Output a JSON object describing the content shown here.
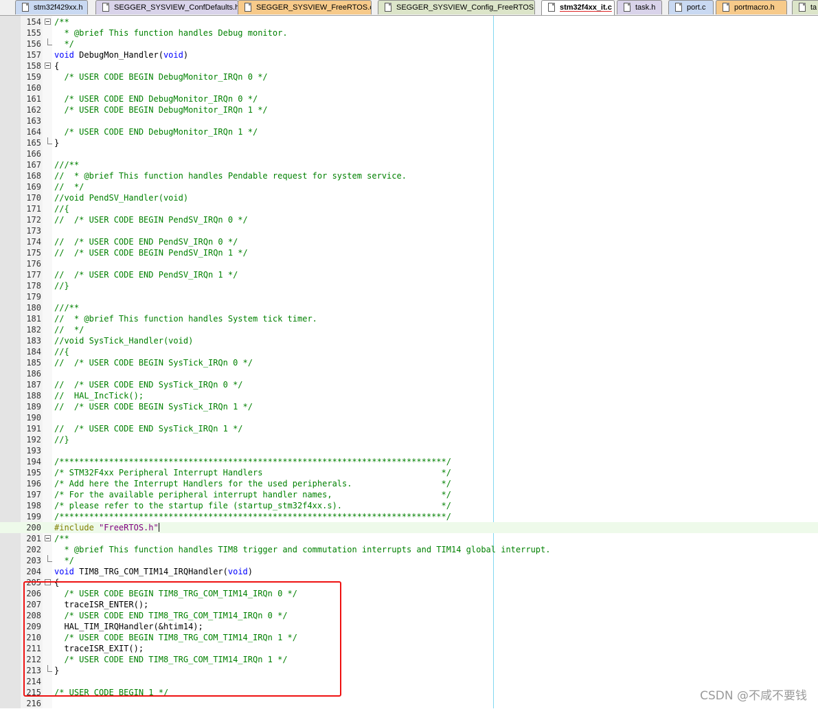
{
  "tabs": [
    {
      "label": "stm32f429xx.h",
      "color": "blue"
    },
    {
      "label": "SEGGER_SYSVIEW_ConfDefaults.h",
      "color": "purple"
    },
    {
      "label": "SEGGER_SYSVIEW_FreeRTOS.c",
      "color": "orange"
    },
    {
      "label": "SEGGER_SYSVIEW_Config_FreeRTOS.c",
      "color": "green"
    },
    {
      "label": "stm32f4xx_it.c",
      "color": "active"
    },
    {
      "label": "task.h",
      "color": "purple"
    },
    {
      "label": "port.c",
      "color": "blue"
    },
    {
      "label": "portmacro.h",
      "color": "orange"
    },
    {
      "label": "ta",
      "color": "green"
    }
  ],
  "editor": {
    "lines": [
      {
        "n": "154",
        "text": "/**",
        "type": "comment",
        "fold": "open"
      },
      {
        "n": "155",
        "text": "  * @brief This function handles Debug monitor.",
        "type": "comment"
      },
      {
        "n": "156",
        "text": "  */",
        "type": "comment",
        "fold": "end"
      },
      {
        "n": "157",
        "text": "void DebugMon_Handler(void)",
        "type": "sig"
      },
      {
        "n": "158",
        "text": "{",
        "type": "code",
        "fold": "open"
      },
      {
        "n": "159",
        "text": "  /* USER CODE BEGIN DebugMonitor_IRQn 0 */",
        "type": "comment"
      },
      {
        "n": "160",
        "text": "",
        "type": "code"
      },
      {
        "n": "161",
        "text": "  /* USER CODE END DebugMonitor_IRQn 0 */",
        "type": "comment"
      },
      {
        "n": "162",
        "text": "  /* USER CODE BEGIN DebugMonitor_IRQn 1 */",
        "type": "comment"
      },
      {
        "n": "163",
        "text": "",
        "type": "code"
      },
      {
        "n": "164",
        "text": "  /* USER CODE END DebugMonitor_IRQn 1 */",
        "type": "comment"
      },
      {
        "n": "165",
        "text": "}",
        "type": "code",
        "fold": "end"
      },
      {
        "n": "166",
        "text": "",
        "type": "code"
      },
      {
        "n": "167",
        "text": "///**",
        "type": "comment"
      },
      {
        "n": "168",
        "text": "//  * @brief This function handles Pendable request for system service.",
        "type": "comment"
      },
      {
        "n": "169",
        "text": "//  */",
        "type": "comment"
      },
      {
        "n": "170",
        "text": "//void PendSV_Handler(void)",
        "type": "comment"
      },
      {
        "n": "171",
        "text": "//{",
        "type": "comment"
      },
      {
        "n": "172",
        "text": "//  /* USER CODE BEGIN PendSV_IRQn 0 */",
        "type": "comment"
      },
      {
        "n": "173",
        "text": "",
        "type": "code"
      },
      {
        "n": "174",
        "text": "//  /* USER CODE END PendSV_IRQn 0 */",
        "type": "comment"
      },
      {
        "n": "175",
        "text": "//  /* USER CODE BEGIN PendSV_IRQn 1 */",
        "type": "comment"
      },
      {
        "n": "176",
        "text": "",
        "type": "code"
      },
      {
        "n": "177",
        "text": "//  /* USER CODE END PendSV_IRQn 1 */",
        "type": "comment"
      },
      {
        "n": "178",
        "text": "//}",
        "type": "comment"
      },
      {
        "n": "179",
        "text": "",
        "type": "code"
      },
      {
        "n": "180",
        "text": "///**",
        "type": "comment"
      },
      {
        "n": "181",
        "text": "//  * @brief This function handles System tick timer.",
        "type": "comment"
      },
      {
        "n": "182",
        "text": "//  */",
        "type": "comment"
      },
      {
        "n": "183",
        "text": "//void SysTick_Handler(void)",
        "type": "comment"
      },
      {
        "n": "184",
        "text": "//{",
        "type": "comment"
      },
      {
        "n": "185",
        "text": "//  /* USER CODE BEGIN SysTick_IRQn 0 */",
        "type": "comment"
      },
      {
        "n": "186",
        "text": "",
        "type": "code"
      },
      {
        "n": "187",
        "text": "//  /* USER CODE END SysTick_IRQn 0 */",
        "type": "comment"
      },
      {
        "n": "188",
        "text": "//  HAL_IncTick();",
        "type": "comment"
      },
      {
        "n": "189",
        "text": "//  /* USER CODE BEGIN SysTick_IRQn 1 */",
        "type": "comment"
      },
      {
        "n": "190",
        "text": "",
        "type": "code"
      },
      {
        "n": "191",
        "text": "//  /* USER CODE END SysTick_IRQn 1 */",
        "type": "comment"
      },
      {
        "n": "192",
        "text": "//}",
        "type": "comment"
      },
      {
        "n": "193",
        "text": "",
        "type": "code"
      },
      {
        "n": "194",
        "text": "/******************************************************************************/",
        "type": "comment"
      },
      {
        "n": "195",
        "text": "/* STM32F4xx Peripheral Interrupt Handlers                                    */",
        "type": "comment"
      },
      {
        "n": "196",
        "text": "/* Add here the Interrupt Handlers for the used peripherals.                  */",
        "type": "comment"
      },
      {
        "n": "197",
        "text": "/* For the available peripheral interrupt handler names,                      */",
        "type": "comment"
      },
      {
        "n": "198",
        "text": "/* please refer to the startup file (startup_stm32f4xx.s).                    */",
        "type": "comment"
      },
      {
        "n": "199",
        "text": "/******************************************************************************/",
        "type": "comment"
      },
      {
        "n": "200",
        "text": "#include \"FreeRTOS.h\"",
        "type": "include",
        "current": true
      },
      {
        "n": "201",
        "text": "/**",
        "type": "comment",
        "fold": "open"
      },
      {
        "n": "202",
        "text": "  * @brief This function handles TIM8 trigger and commutation interrupts and TIM14 global interrupt.",
        "type": "comment"
      },
      {
        "n": "203",
        "text": "  */",
        "type": "comment",
        "fold": "end"
      },
      {
        "n": "204",
        "text": "void TIM8_TRG_COM_TIM14_IRQHandler(void)",
        "type": "sig"
      },
      {
        "n": "205",
        "text": "{",
        "type": "code",
        "fold": "open"
      },
      {
        "n": "206",
        "text": "  /* USER CODE BEGIN TIM8_TRG_COM_TIM14_IRQn 0 */",
        "type": "comment"
      },
      {
        "n": "207",
        "text": "  traceISR_ENTER();",
        "type": "code"
      },
      {
        "n": "208",
        "text": "  /* USER CODE END TIM8_TRG_COM_TIM14_IRQn 0 */",
        "type": "comment"
      },
      {
        "n": "209",
        "text": "  HAL_TIM_IRQHandler(&htim14);",
        "type": "code"
      },
      {
        "n": "210",
        "text": "  /* USER CODE BEGIN TIM8_TRG_COM_TIM14_IRQn 1 */",
        "type": "comment"
      },
      {
        "n": "211",
        "text": "  traceISR_EXIT();",
        "type": "code"
      },
      {
        "n": "212",
        "text": "  /* USER CODE END TIM8_TRG_COM_TIM14_IRQn 1 */",
        "type": "comment"
      },
      {
        "n": "213",
        "text": "}",
        "type": "code",
        "fold": "end"
      },
      {
        "n": "214",
        "text": "",
        "type": "code"
      },
      {
        "n": "215",
        "text": "/* USER CODE BEGIN 1 */",
        "type": "comment"
      },
      {
        "n": "216",
        "text": "",
        "type": "code"
      }
    ]
  },
  "watermark": "CSDN @不咸不要钱",
  "colors": {
    "comment": "#008000",
    "keyword": "#0000ff",
    "preprocessor": "#808000",
    "string": "#800080",
    "annotation_box": "#ee1111",
    "current_line": "#eefaea"
  }
}
